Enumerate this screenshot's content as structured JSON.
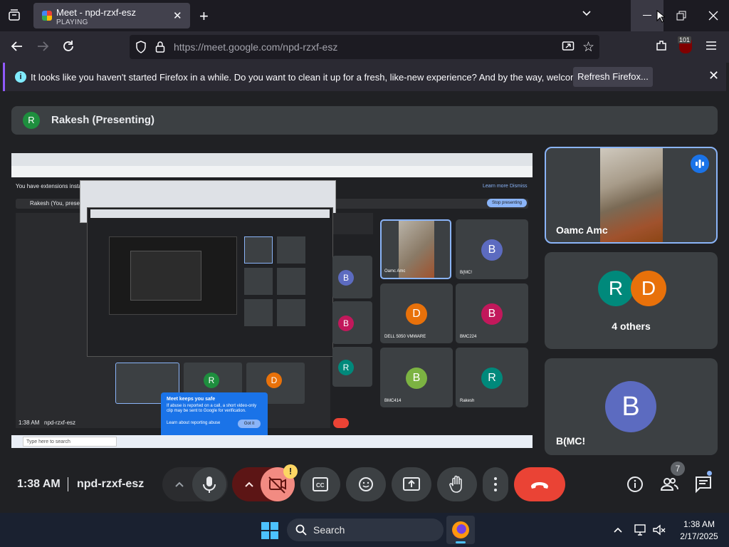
{
  "browser": {
    "tab": {
      "title": "Meet - npd-rzxf-esz",
      "subtitle": "PLAYING"
    },
    "url": "https://meet.google.com/npd-rzxf-esz",
    "badge_count": "101"
  },
  "notification": {
    "text": "It looks like you haven't started Firefox in a while. Do you want to clean it up for a fresh, like-new experience? And by the way, welcome back!",
    "button": "Refresh Firefox..."
  },
  "meet": {
    "presenter": {
      "initial": "R",
      "label": "Rakesh (Presenting)"
    },
    "tiles": [
      {
        "name": "Oamc Amc"
      },
      {
        "name": "4 others",
        "initials": [
          "R",
          "D"
        ]
      },
      {
        "name": "B(MC!",
        "initial": "B"
      }
    ],
    "time": "1:38 AM",
    "meeting_code": "npd-rzxf-esz",
    "people_count": "7",
    "shared_screen": {
      "banner": "You have extensions installed that",
      "presenting": "Rakesh (You, presenting)",
      "stop_btn": "Stop presenting",
      "learn_more": "Learn more",
      "dismiss": "Dismiss",
      "tiles": [
        "Oamc Amc",
        "B(MC!",
        "DELL 5050 VMWARE",
        "BMC224",
        "BMC414",
        "Rakesh"
      ],
      "tile_initials": [
        "",
        "B",
        "D",
        "B",
        "B",
        "R"
      ],
      "time": "1:38 AM",
      "code": "npd-rzxf-esz",
      "safe_title": "Meet keeps you safe",
      "safe_text": "If abuse is reported on a call, a short video-only clip may be sent to Google for verification.",
      "safe_link": "Learn about reporting abuse",
      "safe_ok": "Got it",
      "taskbar_search": "Type here to search"
    }
  },
  "taskbar": {
    "search": "Search",
    "time": "1:38 AM",
    "date": "2/17/2025"
  },
  "colors": {
    "accent_blue": "#8ab4f8",
    "end_call": "#ea4335",
    "green_avatar": "#1e8e3e",
    "orange_avatar": "#e8710a",
    "blue_avatar": "#5c6bc0"
  }
}
